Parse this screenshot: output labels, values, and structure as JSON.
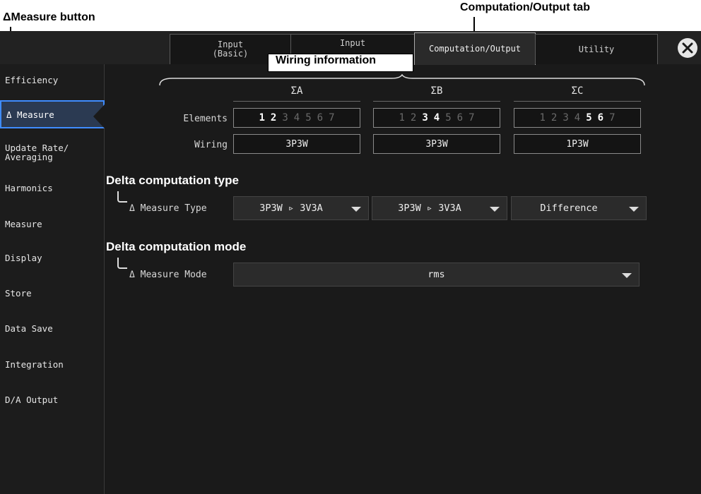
{
  "annotations": {
    "delta_button": "ΔMeasure button",
    "comp_tab": "Computation/Output tab",
    "wiring_info": "Wiring information"
  },
  "tabs": [
    {
      "label": "Input\n(Basic)"
    },
    {
      "label": "Input"
    },
    {
      "label": "Computation/Output"
    },
    {
      "label": "Utility"
    }
  ],
  "sidebar": {
    "items": [
      {
        "label": "Efficiency"
      },
      {
        "label": "Δ Measure"
      },
      {
        "label": "Update Rate/\nAveraging"
      },
      {
        "label": "Harmonics"
      },
      {
        "label": "Measure"
      },
      {
        "label": "Display"
      },
      {
        "label": "Store"
      },
      {
        "label": "Data Save"
      },
      {
        "label": "Integration"
      },
      {
        "label": "D/A Output"
      }
    ]
  },
  "wiring": {
    "columns": [
      {
        "head": "ΣA",
        "wiring": "3P3W",
        "elements": [
          true,
          true,
          false,
          false,
          false,
          false,
          false
        ]
      },
      {
        "head": "ΣB",
        "wiring": "3P3W",
        "elements": [
          false,
          false,
          true,
          true,
          false,
          false,
          false
        ]
      },
      {
        "head": "ΣC",
        "wiring": "1P3W",
        "elements": [
          false,
          false,
          false,
          false,
          true,
          true,
          false
        ]
      }
    ],
    "elements_label": "Elements",
    "wiring_label": "Wiring",
    "element_numbers": [
      "1",
      "2",
      "3",
      "4",
      "5",
      "6",
      "7"
    ]
  },
  "delta_type": {
    "section_title": "Delta computation type",
    "label": "Δ Measure Type",
    "values": [
      "3P3W ▹ 3V3A",
      "3P3W ▹ 3V3A",
      "Difference"
    ]
  },
  "delta_mode": {
    "section_title": "Delta computation mode",
    "label": "Δ Measure Mode",
    "value": "rms"
  }
}
